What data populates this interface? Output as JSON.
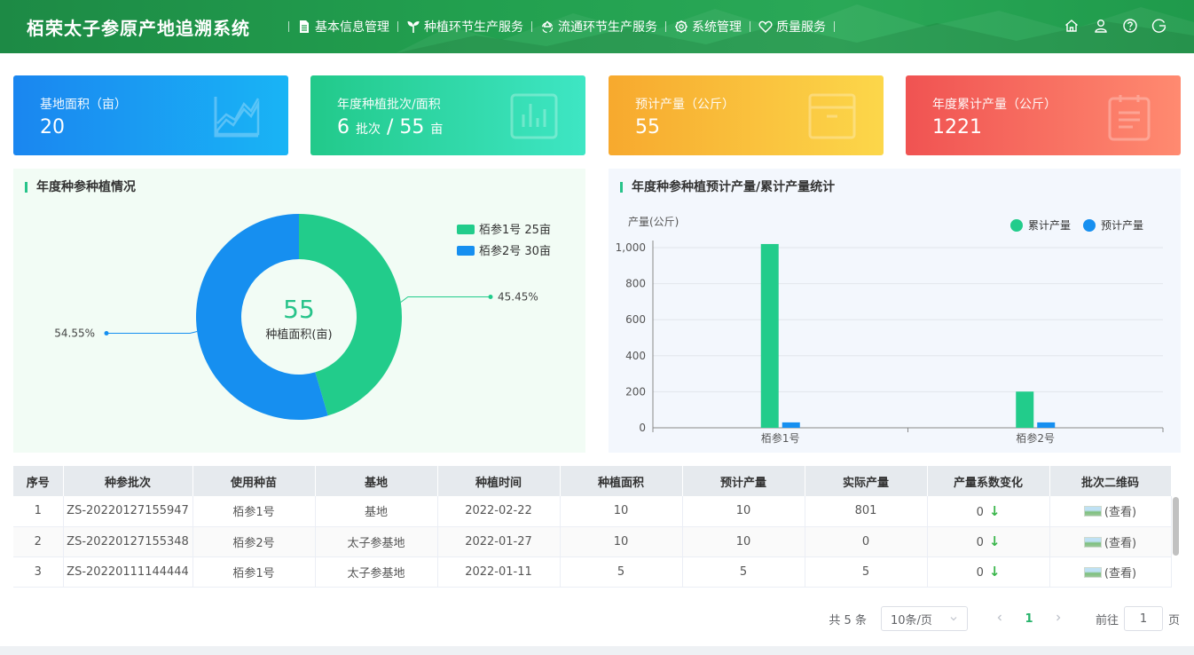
{
  "header": {
    "app_title": "栢荣太子参原产地追溯系统",
    "nav": [
      {
        "label": "基本信息管理",
        "icon": "document-icon"
      },
      {
        "label": "种植环节生产服务",
        "icon": "sprout-icon"
      },
      {
        "label": "流通环节生产服务",
        "icon": "recycle-icon"
      },
      {
        "label": "系统管理",
        "icon": "gear-icon"
      },
      {
        "label": "质量服务",
        "icon": "heart-icon"
      }
    ],
    "tools": [
      "home-icon",
      "user-icon",
      "help-icon",
      "logout-icon"
    ]
  },
  "cards": [
    {
      "label": "基地面积（亩）",
      "value": "20",
      "icon": "area-chart-icon",
      "color": "#1a86f0"
    },
    {
      "label": "年度种植批次/面积",
      "value_parts": [
        "6",
        "批次",
        "/",
        "55",
        "亩"
      ],
      "icon": "bar-chart-icon",
      "color": "#22c98a"
    },
    {
      "label": "预计产量（公斤）",
      "value": "55",
      "icon": "box-icon",
      "color": "#f7a92e"
    },
    {
      "label": "年度累计产量（公斤）",
      "value": "1221",
      "icon": "clipboard-icon",
      "color": "#f05352"
    }
  ],
  "panel_left": {
    "title": "年度种参种植情况",
    "center_value": "55",
    "center_label": "种植面积(亩)"
  },
  "panel_right": {
    "title": "年度种参种植预计产量/累计产量统计"
  },
  "chart_data": [
    {
      "type": "pie",
      "donut": true,
      "categories": [
        "栢参1号",
        "栢参2号"
      ],
      "values": [
        25,
        30
      ],
      "legend": [
        "栢参1号 25亩",
        "栢参2号 30亩"
      ],
      "slice_labels": [
        "45.45%",
        "54.55%"
      ],
      "colors": [
        "#22cc8b",
        "#168ff0"
      ],
      "legend_position": "top-right"
    },
    {
      "type": "bar",
      "categories": [
        "栢参1号",
        "栢参2号"
      ],
      "ylabel": "产量(公斤)",
      "ylim": [
        0,
        1000
      ],
      "yticks": [
        "0",
        "200",
        "400",
        "600",
        "800",
        "1,000"
      ],
      "series": [
        {
          "name": "累计产量",
          "values": [
            1020,
            201
          ],
          "color": "#22cc8b"
        },
        {
          "name": "预计产量",
          "values": [
            30,
            30
          ],
          "color": "#168ff0"
        }
      ],
      "grid": true,
      "legend_position": "top-right"
    }
  ],
  "table": {
    "columns": [
      "序号",
      "种参批次",
      "使用种苗",
      "基地",
      "种植时间",
      "种植面积",
      "预计产量",
      "实际产量",
      "产量系数变化",
      "批次二维码"
    ],
    "rows": [
      [
        "1",
        "ZS-20220127155947",
        "栢参1号",
        "基地",
        "2022-02-22",
        "10",
        "10",
        "801",
        "0",
        "(查看)"
      ],
      [
        "2",
        "ZS-20220127155348",
        "栢参2号",
        "太子参基地",
        "2022-01-27",
        "10",
        "10",
        "0",
        "0",
        "(查看)"
      ],
      [
        "3",
        "ZS-20220111144444",
        "栢参1号",
        "太子参基地",
        "2022-01-11",
        "5",
        "5",
        "5",
        "0",
        "(查看)"
      ]
    ],
    "trend_symbol": "↓"
  },
  "pagination": {
    "total": "共 5 条",
    "page_size": "10条/页",
    "current_page": "1",
    "goto_prefix": "前往",
    "goto_value": "1",
    "goto_suffix": "页"
  }
}
